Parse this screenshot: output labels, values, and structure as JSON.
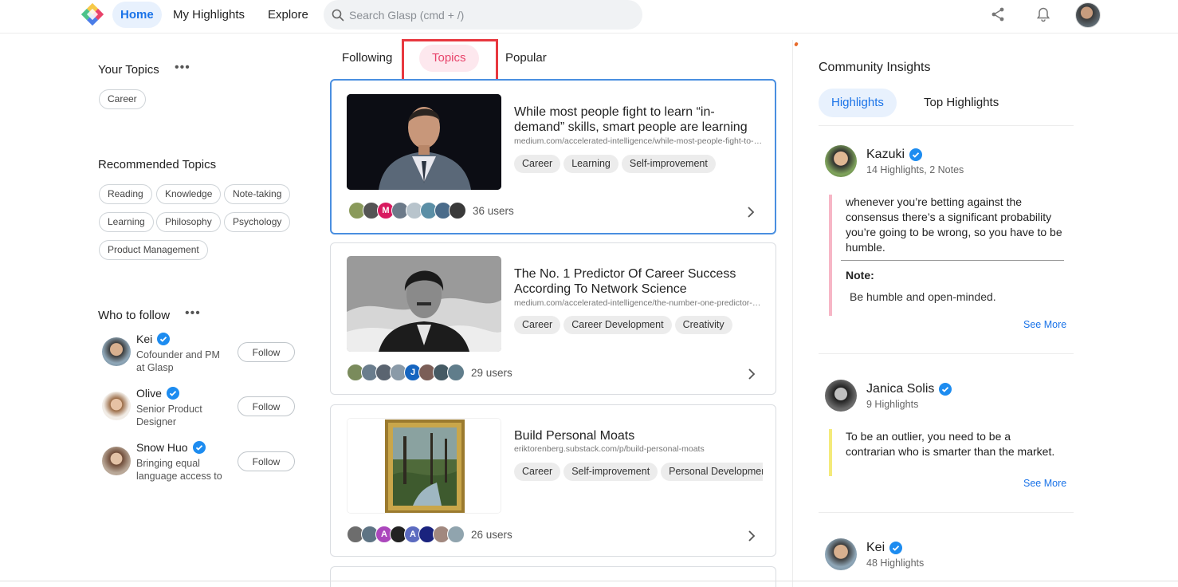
{
  "header": {
    "nav": [
      "Home",
      "My Highlights",
      "Explore"
    ],
    "search_placeholder": "Search Glasp (cmd + /)"
  },
  "left": {
    "your_topics_title": "Your Topics",
    "your_topics": [
      "Career"
    ],
    "recommended_title": "Recommended Topics",
    "recommended": [
      "Reading",
      "Knowledge",
      "Note-taking",
      "Learning",
      "Philosophy",
      "Psychology",
      "Product Management"
    ],
    "who_to_follow_title": "Who to follow",
    "people": [
      {
        "name": "Kei",
        "bio": "Cofounder and PM at Glasp",
        "button": "Follow"
      },
      {
        "name": "Olive",
        "bio": "Senior Product Designer",
        "button": "Follow"
      },
      {
        "name": "Snow Huo",
        "bio": "Bringing equal language access to",
        "button": "Follow"
      }
    ]
  },
  "feed": {
    "tabs": [
      "Following",
      "Topics",
      "Popular"
    ],
    "active_tab": "Topics",
    "cards": [
      {
        "title": "While most people fight to learn “in-demand” skills, smart people are learning",
        "url": "medium.com/accelerated-intelligence/while-most-people-fight-to-learn",
        "tags": [
          "Career",
          "Learning",
          "Self-improvement"
        ],
        "users": "36 users",
        "avatars": [
          "",
          "",
          "M",
          "",
          "",
          "",
          "",
          ""
        ]
      },
      {
        "title": "The No. 1 Predictor Of Career Success According To Network Science",
        "url": "medium.com/accelerated-intelligence/the-number-one-predictor-of-career-success",
        "tags": [
          "Career",
          "Career Development",
          "Creativity"
        ],
        "users": "29 users",
        "avatars": [
          "",
          "",
          "",
          "",
          "J",
          "",
          "",
          ""
        ]
      },
      {
        "title": "Build Personal Moats",
        "url": "eriktorenberg.substack.com/p/build-personal-moats",
        "tags": [
          "Career",
          "Self-improvement",
          "Personal Development"
        ],
        "users": "26 users",
        "avatars": [
          "",
          "",
          "A",
          "",
          "A",
          "",
          "",
          ""
        ]
      }
    ]
  },
  "insights": {
    "title": "Community Insights",
    "tabs": [
      "Highlights",
      "Top Highlights"
    ],
    "active_tab": "Highlights",
    "items": [
      {
        "name": "Kazuki",
        "meta": "14 Highlights, 2 Notes",
        "quote": "whenever you’re betting against the consensus there’s a significant probability you’re going to be wrong, so you have to be humble.",
        "note_label": "Note:",
        "note": "Be humble and open-minded.",
        "see_more": "See More",
        "color": "#f7b6c6"
      },
      {
        "name": "Janica Solis",
        "meta": "9 Highlights",
        "quote": "To be an outlier, you need to be a contrarian who is smarter than the market.",
        "see_more": "See More",
        "color": "#f4ea7a"
      },
      {
        "name": "Kei",
        "meta": "48 Highlights"
      }
    ]
  },
  "colors": {
    "accent_blue": "#1a73e8",
    "accent_pink": "#e8436a",
    "annotation_red": "#e8383f"
  }
}
